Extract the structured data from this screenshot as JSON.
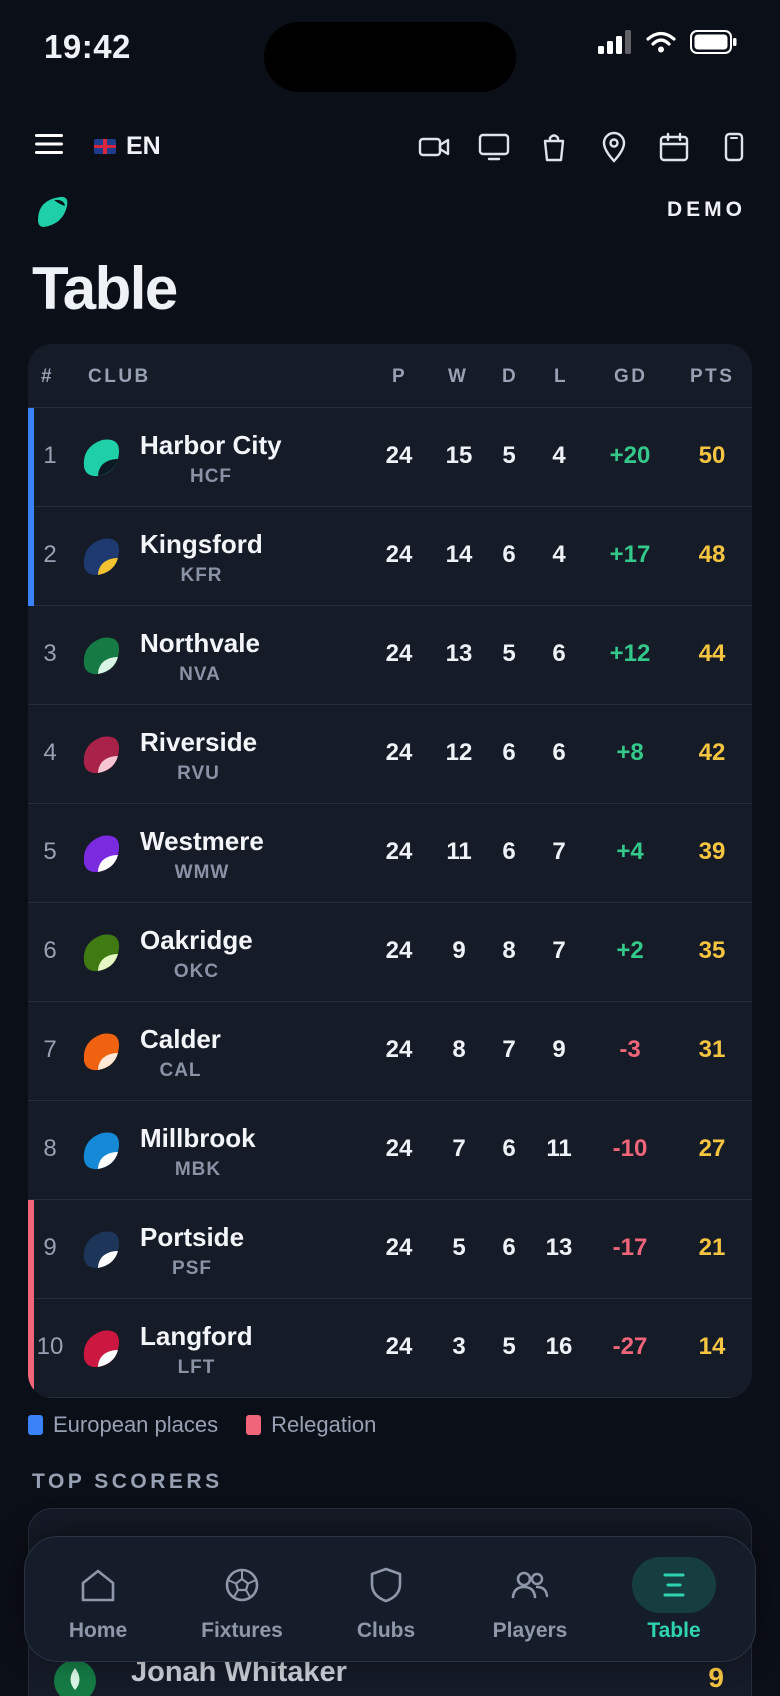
{
  "status_bar": {
    "time": "19:42"
  },
  "toolbar": {
    "language": "EN"
  },
  "brand": {
    "demo_label": "DEMO"
  },
  "page": {
    "title": "Table"
  },
  "table": {
    "headers": {
      "pos": "#",
      "club": "CLUB",
      "p": "P",
      "w": "W",
      "d": "D",
      "l": "L",
      "gd": "GD",
      "pts": "PTS"
    },
    "rows": [
      {
        "pos": "1",
        "name": "Harbor City",
        "code": "HCF",
        "p": "24",
        "w": "15",
        "d": "5",
        "l": "4",
        "gd": "+20",
        "pts": "50",
        "zone": "european",
        "badge": [
          "#1fcfa8",
          "#0d1a24"
        ]
      },
      {
        "pos": "2",
        "name": "Kingsford",
        "code": "KFR",
        "p": "24",
        "w": "14",
        "d": "6",
        "l": "4",
        "gd": "+17",
        "pts": "48",
        "zone": "european",
        "badge": [
          "#1e3a70",
          "#f2c230"
        ]
      },
      {
        "pos": "3",
        "name": "Northvale",
        "code": "NVA",
        "p": "24",
        "w": "13",
        "d": "5",
        "l": "6",
        "gd": "+12",
        "pts": "44",
        "zone": "none",
        "badge": [
          "#157a44",
          "#d9f5e4"
        ]
      },
      {
        "pos": "4",
        "name": "Riverside",
        "code": "RVU",
        "p": "24",
        "w": "12",
        "d": "6",
        "l": "6",
        "gd": "+8",
        "pts": "42",
        "zone": "none",
        "badge": [
          "#a8224a",
          "#f7c6d2"
        ]
      },
      {
        "pos": "5",
        "name": "Westmere",
        "code": "WMW",
        "p": "24",
        "w": "11",
        "d": "6",
        "l": "7",
        "gd": "+4",
        "pts": "39",
        "zone": "none",
        "badge": [
          "#7a2be0",
          "#ffffff"
        ]
      },
      {
        "pos": "6",
        "name": "Oakridge",
        "code": "OKC",
        "p": "24",
        "w": "9",
        "d": "8",
        "l": "7",
        "gd": "+2",
        "pts": "35",
        "zone": "none",
        "badge": [
          "#3f7a12",
          "#e6f7c4"
        ]
      },
      {
        "pos": "7",
        "name": "Calder",
        "code": "CAL",
        "p": "24",
        "w": "8",
        "d": "7",
        "l": "9",
        "gd": "-3",
        "pts": "31",
        "zone": "none",
        "badge": [
          "#f0620f",
          "#ffe9d6"
        ]
      },
      {
        "pos": "8",
        "name": "Millbrook",
        "code": "MBK",
        "p": "24",
        "w": "7",
        "d": "6",
        "l": "11",
        "gd": "-10",
        "pts": "27",
        "zone": "none",
        "badge": [
          "#1588d6",
          "#ffffff"
        ]
      },
      {
        "pos": "9",
        "name": "Portside",
        "code": "PSF",
        "p": "24",
        "w": "5",
        "d": "6",
        "l": "13",
        "gd": "-17",
        "pts": "21",
        "zone": "relegation",
        "badge": [
          "#1d3558",
          "#ffffff"
        ]
      },
      {
        "pos": "10",
        "name": "Langford",
        "code": "LFT",
        "p": "24",
        "w": "3",
        "d": "5",
        "l": "16",
        "gd": "-27",
        "pts": "14",
        "zone": "relegation",
        "badge": [
          "#cc1840",
          "#ffffff"
        ]
      }
    ]
  },
  "legend": {
    "european": "European places",
    "relegation": "Relegation"
  },
  "top_scorers": {
    "title": "TOP SCORERS",
    "first": {
      "name": "Jonah Whitaker",
      "goals": "9"
    }
  },
  "nav": {
    "items": [
      {
        "label": "Home",
        "icon": "home-icon"
      },
      {
        "label": "Fixtures",
        "icon": "ball-icon"
      },
      {
        "label": "Clubs",
        "icon": "shield-icon"
      },
      {
        "label": "Players",
        "icon": "players-icon"
      },
      {
        "label": "Table",
        "icon": "table-icon"
      }
    ],
    "active": "Table"
  },
  "colors": {
    "accent": "#2ed3b1",
    "european": "#3b82f6",
    "relegation": "#f0657a",
    "positive_gd": "#34c98a",
    "negative_gd": "#f0657a",
    "points": "#f5c542"
  }
}
